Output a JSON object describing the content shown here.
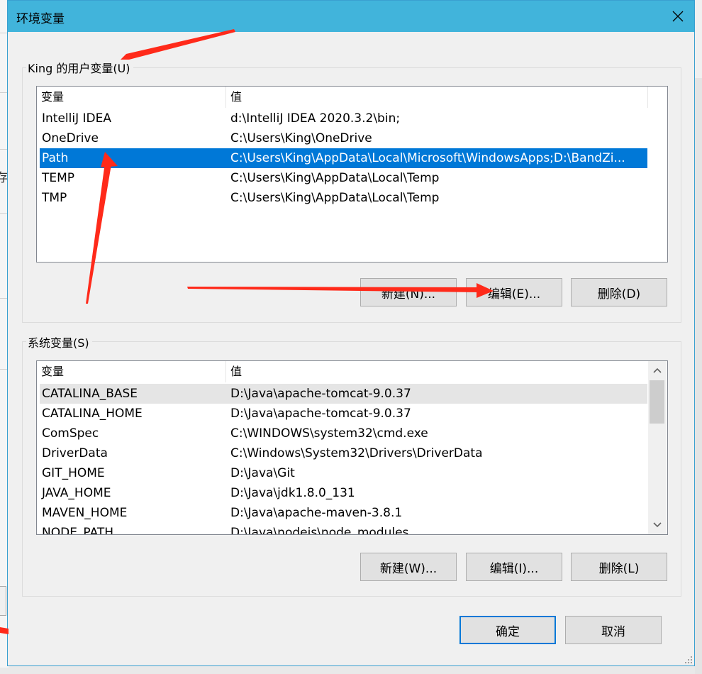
{
  "window": {
    "title": "环境变量"
  },
  "user_vars": {
    "group_label": "King 的用户变量(U)",
    "columns": [
      "变量",
      "值"
    ],
    "rows": [
      {
        "name": "IntelliJ IDEA",
        "value": "d:\\IntelliJ IDEA 2020.3.2\\bin;"
      },
      {
        "name": "OneDrive",
        "value": "C:\\Users\\King\\OneDrive"
      },
      {
        "name": "Path",
        "value": "C:\\Users\\King\\AppData\\Local\\Microsoft\\WindowsApps;D:\\BandZi..."
      },
      {
        "name": "TEMP",
        "value": "C:\\Users\\King\\AppData\\Local\\Temp"
      },
      {
        "name": "TMP",
        "value": "C:\\Users\\King\\AppData\\Local\\Temp"
      }
    ],
    "selected_row": "Path",
    "buttons": {
      "new": "新建(N)...",
      "edit": "编辑(E)...",
      "delete": "删除(D)"
    }
  },
  "system_vars": {
    "group_label": "系统变量(S)",
    "columns": [
      "变量",
      "值"
    ],
    "rows": [
      {
        "name": "CATALINA_BASE",
        "value": "D:\\Java\\apache-tomcat-9.0.37"
      },
      {
        "name": "CATALINA_HOME",
        "value": "D:\\Java\\apache-tomcat-9.0.37"
      },
      {
        "name": "ComSpec",
        "value": "C:\\WINDOWS\\system32\\cmd.exe"
      },
      {
        "name": "DriverData",
        "value": "C:\\Windows\\System32\\Drivers\\DriverData"
      },
      {
        "name": "GIT_HOME",
        "value": "D:\\Java\\Git"
      },
      {
        "name": "JAVA_HOME",
        "value": "D:\\Java\\jdk1.8.0_131"
      },
      {
        "name": "MAVEN_HOME",
        "value": "D:\\Java\\apache-maven-3.8.1"
      },
      {
        "name": "NODE_PATH",
        "value": "D:\\Java\\nodejs\\node_modules"
      }
    ],
    "buttons": {
      "new": "新建(W)...",
      "edit": "编辑(I)...",
      "delete": "删除(L)"
    }
  },
  "footer": {
    "ok": "确定",
    "cancel": "取消"
  },
  "colors": {
    "title_bar": "#41b4db",
    "selection": "#0078d7",
    "annotation_arrow": "#ff2a1a"
  },
  "icons": {
    "close": "close-icon",
    "scroll_up": "chevron-up-icon",
    "scroll_down": "chevron-down-icon"
  },
  "background": {
    "partial_char": "存"
  }
}
